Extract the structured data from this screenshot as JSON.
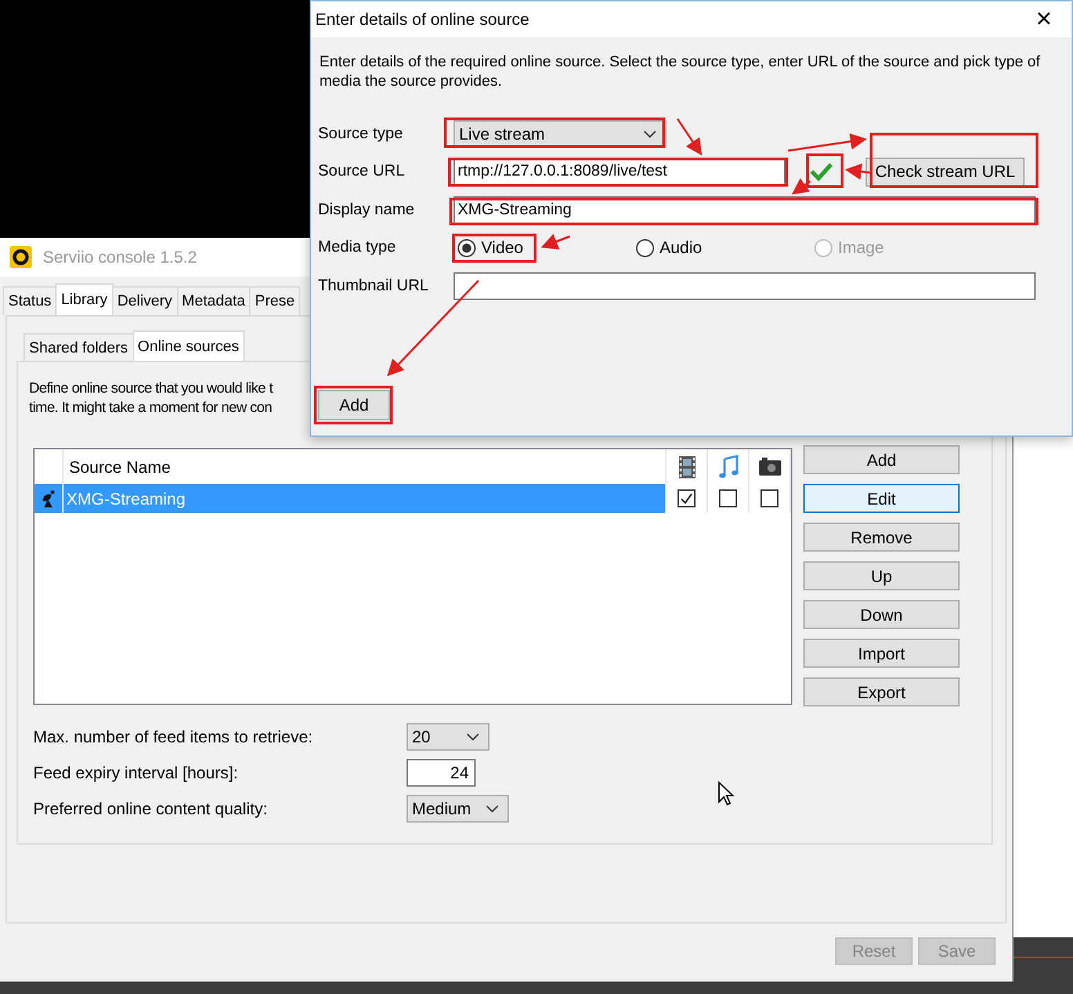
{
  "main_window": {
    "title": "Serviio console 1.5.2",
    "tabs": [
      {
        "label": "Status",
        "selected": false
      },
      {
        "label": "Library",
        "selected": true
      },
      {
        "label": "Delivery",
        "selected": false
      },
      {
        "label": "Metadata",
        "selected": false
      },
      {
        "label": "Prese",
        "selected": false
      }
    ],
    "subtabs": [
      {
        "label": "Shared folders",
        "selected": false
      },
      {
        "label": "Online sources",
        "selected": true
      }
    ],
    "description_lines": [
      "Define online source that you would like t",
      "time. It might take a moment for new con"
    ],
    "table": {
      "columns": [
        "Source Name"
      ],
      "rows": [
        {
          "name": "XMG-Streaming",
          "selected": true,
          "video": true,
          "audio": false,
          "image": false
        }
      ]
    },
    "side_buttons": [
      {
        "label": "Add",
        "focused": false
      },
      {
        "label": "Edit",
        "focused": true
      },
      {
        "label": "Remove",
        "focused": false
      },
      {
        "label": "Up",
        "focused": false
      },
      {
        "label": "Down",
        "focused": false
      },
      {
        "label": "Import",
        "focused": false
      },
      {
        "label": "Export",
        "focused": false
      }
    ],
    "settings": [
      {
        "kind": "select",
        "label": "Max. number of feed items to retrieve:",
        "value": "20"
      },
      {
        "kind": "number",
        "label": "Feed expiry interval [hours]:",
        "value": "24"
      },
      {
        "kind": "select",
        "label": "Preferred online content quality:",
        "value": "Medium"
      }
    ],
    "footer_buttons": [
      {
        "label": "Reset",
        "disabled": true
      },
      {
        "label": "Save",
        "disabled": true
      }
    ]
  },
  "dialog": {
    "title": "Enter details of online source",
    "close": "×",
    "description": "Enter details of the required online source. Select the source type, enter URL of the source and pick type of media the source provides.",
    "source_type": {
      "label": "Source type",
      "value": "Live stream"
    },
    "source_url": {
      "label": "Source URL",
      "value": "rtmp://127.0.0.1:8089/live/test",
      "verified": true
    },
    "check_button": "Check stream URL",
    "display_name": {
      "label": "Display name",
      "value": "XMG-Streaming"
    },
    "media_type": {
      "label": "Media type",
      "options": [
        {
          "label": "Video",
          "selected": true,
          "disabled": false
        },
        {
          "label": "Audio",
          "selected": false,
          "disabled": false
        },
        {
          "label": "Image",
          "selected": false,
          "disabled": true
        }
      ]
    },
    "thumbnail_url": {
      "label": "Thumbnail URL"
    },
    "add_button": "Add"
  }
}
